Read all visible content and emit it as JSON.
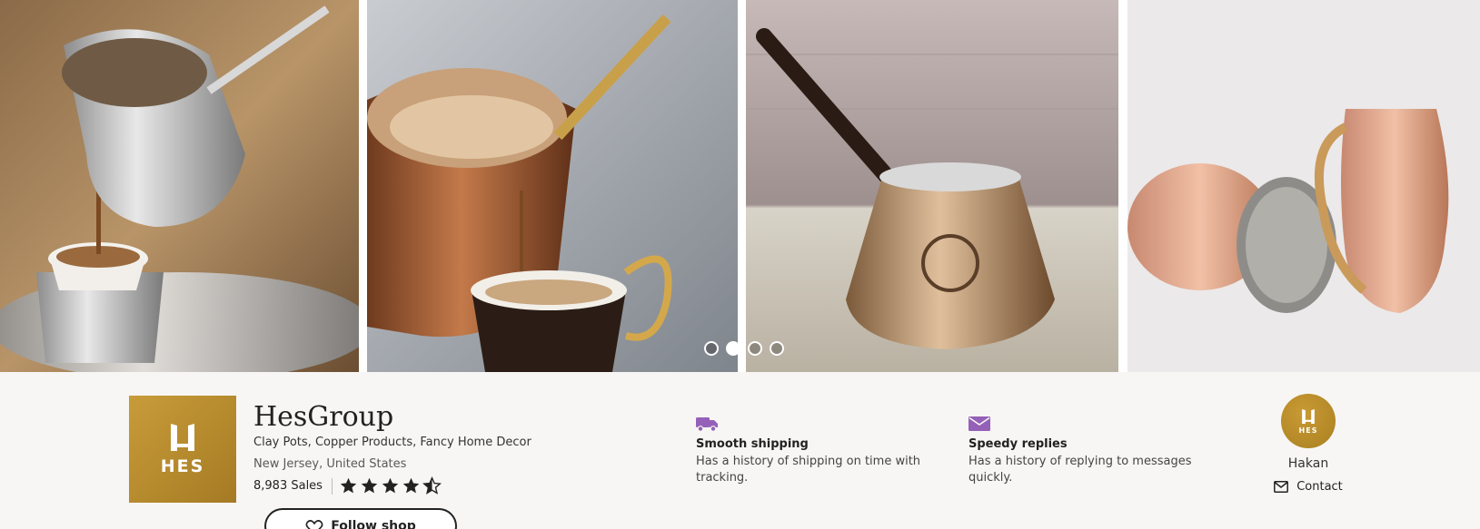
{
  "banner": {
    "images": [
      {
        "icon": "silver-coffee-pot-pouring-photo"
      },
      {
        "icon": "copper-coffee-pot-pouring-photo"
      },
      {
        "icon": "engraved-copper-coffee-pot-photo"
      },
      {
        "icon": "copper-cups-and-pitcher-photo"
      }
    ],
    "carousel_dots": 4,
    "active_dot": 1
  },
  "shop": {
    "logo_text": "HES",
    "name": "HesGroup",
    "tagline": "Clay Pots, Copper Products, Fancy Home Decor",
    "location": "New Jersey, United States",
    "sales": "8,983 Sales",
    "rating": 4.5,
    "follow_label": "Follow shop"
  },
  "perks": [
    {
      "icon": "truck-icon",
      "title": "Smooth shipping",
      "description": "Has a history of shipping on time with tracking."
    },
    {
      "icon": "envelope-icon",
      "title": "Speedy replies",
      "description": "Has a history of replying to messages quickly."
    }
  ],
  "owner": {
    "avatar_text": "HES",
    "name": "Hakan",
    "contact_label": "Contact"
  },
  "colors": {
    "brand_gold": "#b8902f",
    "perk_purple": "#9560b8",
    "background": "#f7f6f4"
  }
}
